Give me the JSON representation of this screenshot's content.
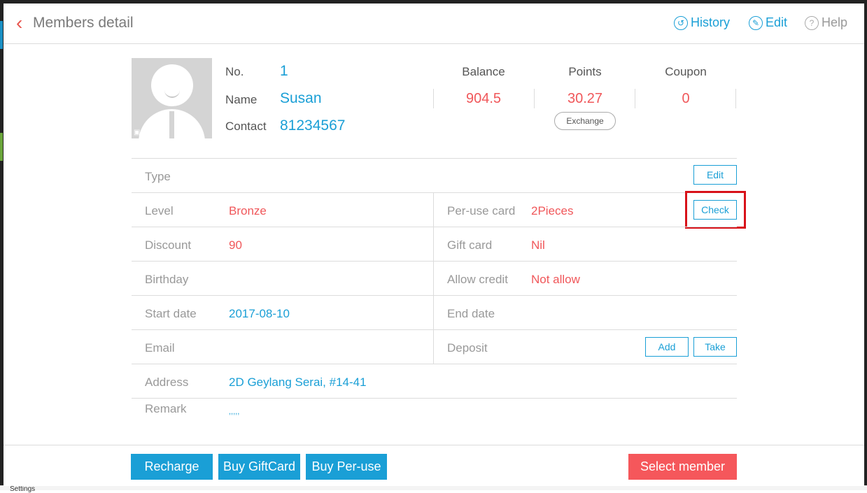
{
  "header": {
    "back_icon": "chevron-left-icon",
    "title": "Members detail",
    "history_label": "History",
    "edit_label": "Edit",
    "help_label": "Help"
  },
  "member": {
    "no_label": "No.",
    "no": "1",
    "name_label": "Name",
    "name": "Susan",
    "contact_label": "Contact",
    "contact": "81234567"
  },
  "stats": {
    "balance_label": "Balance",
    "balance": "904.5",
    "points_label": "Points",
    "points": "30.27",
    "coupon_label": "Coupon",
    "coupon": "0",
    "exchange_label": "Exchange"
  },
  "details": {
    "type_label": "Type",
    "type_edit": "Edit",
    "level_label": "Level",
    "level": "Bronze",
    "peruse_label": "Per-use card",
    "peruse": "2Pieces",
    "check_label": "Check",
    "discount_label": "Discount",
    "discount": "90",
    "giftcard_label": "Gift card",
    "giftcard": "Nil",
    "birthday_label": "Birthday",
    "credit_label": "Allow credit",
    "credit": "Not allow",
    "start_label": "Start date",
    "start": "2017-08-10",
    "end_label": "End date",
    "email_label": "Email",
    "deposit_label": "Deposit",
    "deposit_add": "Add",
    "deposit_take": "Take",
    "address_label": "Address",
    "address": "2D Geylang Serai, #14-41",
    "remark_label": "Remark",
    "remark": ",,,,,"
  },
  "footer": {
    "recharge": "Recharge",
    "buy_giftcard": "Buy GiftCard",
    "buy_peruse": "Buy Per-use",
    "select_member": "Select member"
  },
  "background": {
    "partial_label": "Settings"
  },
  "colors": {
    "accent_blue": "#1a9fd6",
    "accent_red": "#f0575a",
    "highlight": "#d8121a"
  }
}
